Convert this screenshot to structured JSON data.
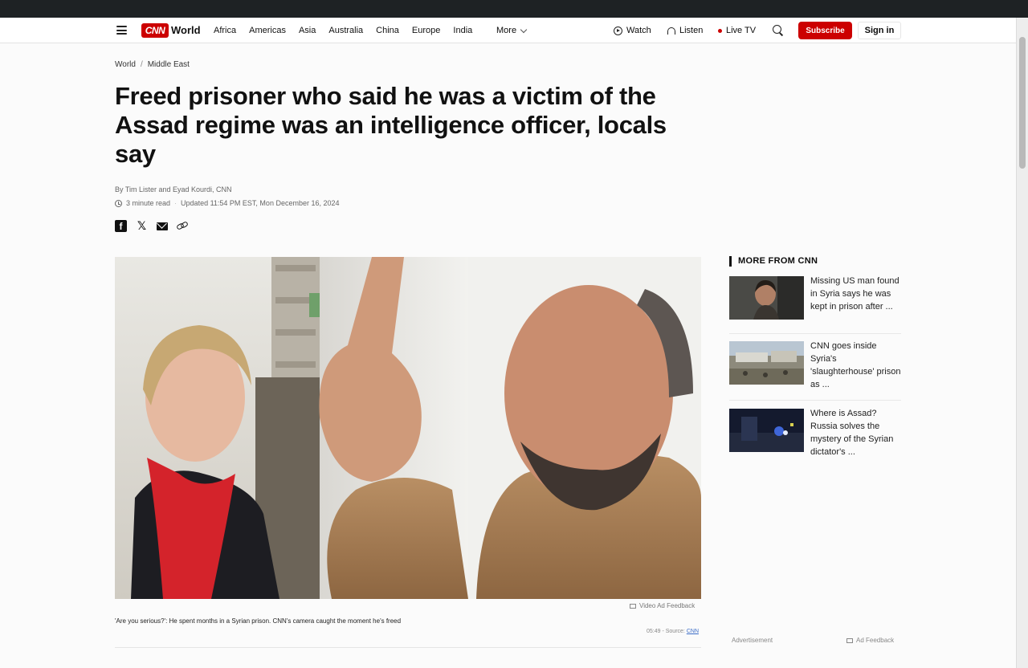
{
  "nav": {
    "logo": "CNN",
    "section": "World",
    "links": [
      "Africa",
      "Americas",
      "Asia",
      "Australia",
      "China",
      "Europe",
      "India"
    ],
    "more_label": "More",
    "watch_label": "Watch",
    "listen_label": "Listen",
    "live_label": "Live TV",
    "subscribe_label": "Subscribe",
    "signin_label": "Sign in"
  },
  "breadcrumb": [
    "World",
    "Middle East"
  ],
  "article": {
    "headline": "Freed prisoner who said he was a victim of the Assad regime was an intelligence officer, locals say",
    "byline": "By Tim Lister and Eyad Kourdi, CNN",
    "read_time": "3 minute read",
    "updated": "Updated 11:54 PM EST, Mon December 16, 2024"
  },
  "video": {
    "ad_feedback": "Video Ad Feedback",
    "caption": "'Are you serious?': He spent months in a Syrian prison. CNN's camera caught the moment he's freed",
    "duration": "05:49 - Source:",
    "source": "CNN"
  },
  "sidebar": {
    "title": "MORE FROM CNN",
    "items": [
      {
        "text": "Missing US man found in Syria says he was kept in prison after ..."
      },
      {
        "text": "CNN goes inside Syria's 'slaughterhouse' prison as ..."
      },
      {
        "text": "Where is Assad? Russia solves the mystery of the Syrian dictator's ..."
      }
    ]
  },
  "ad": {
    "label": "Advertisement",
    "feedback": "Ad Feedback"
  },
  "icons": [
    "menu-icon",
    "play-circle-icon",
    "headphones-icon",
    "live-dot-icon",
    "search-icon",
    "clock-icon",
    "facebook-icon",
    "x-icon",
    "mail-icon",
    "link-icon"
  ],
  "colors": {
    "brand_red": "#cc0000",
    "text": "#0c0c0c",
    "muted": "#666666"
  }
}
